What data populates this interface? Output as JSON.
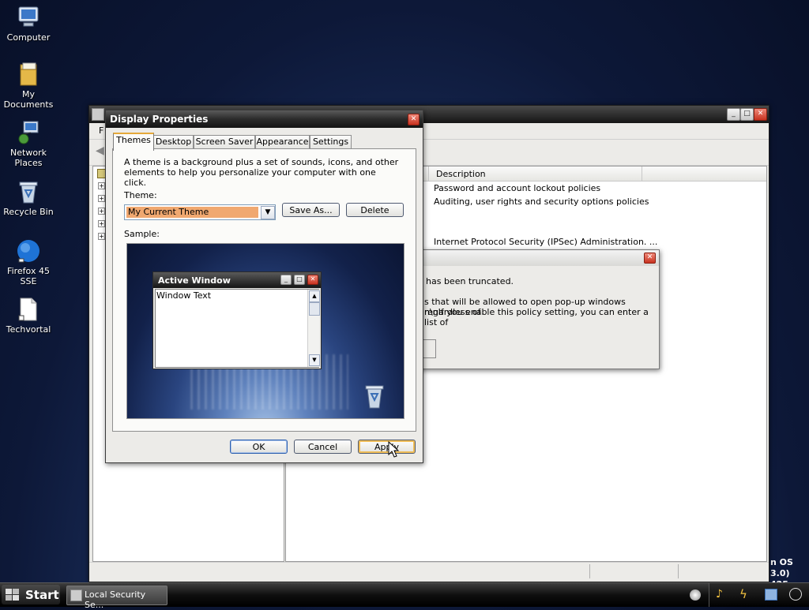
{
  "desktop": {
    "icons": [
      {
        "label": "Computer",
        "icon": "computer-icon"
      },
      {
        "label": "My Documents",
        "icon": "my-documents-icon"
      },
      {
        "label": "Network Places",
        "icon": "network-places-icon"
      },
      {
        "label": "Recycle Bin",
        "icon": "recycle-bin-icon"
      },
      {
        "label": "Firefox 45 SSE",
        "icon": "firefox-icon"
      },
      {
        "label": "Techvortal",
        "icon": "document-icon"
      }
    ],
    "watermark": {
      "line1": "n OS 3.0)",
      "line2": "425-1535"
    }
  },
  "mmc": {
    "menu_visible": "F",
    "table_header": "Description",
    "rows": [
      "Password and account lockout policies",
      "Auditing, user rights and security options policies",
      "Internet Protocol Security (IPSec) Administration. ..."
    ]
  },
  "msgbox": {
    "line1": "has been truncated.",
    "line2": "s that will be allowed to open pop-up windows regardless of",
    "line3": "n\\nIf you enable this policy setting, you can enter a list of"
  },
  "display": {
    "title": "Display Properties",
    "tabs": [
      "Themes",
      "Desktop",
      "Screen Saver",
      "Appearance",
      "Settings"
    ],
    "description": "A theme is a background plus a set of sounds, icons, and other elements to help you personalize your computer with one click.",
    "theme_label": "Theme:",
    "theme_value": "My Current Theme",
    "save_as": "Save As...",
    "delete": "Delete",
    "sample_label": "Sample:",
    "preview": {
      "window_title": "Active Window",
      "window_text": "Window Text"
    },
    "ok": "OK",
    "cancel": "Cancel",
    "apply": "Apply"
  },
  "taskbar": {
    "start": "Start",
    "task": "Local Security Se..."
  },
  "colors": {
    "accent": "#e5a93a",
    "selection": "#f0a870",
    "title_dark": "#151515"
  }
}
